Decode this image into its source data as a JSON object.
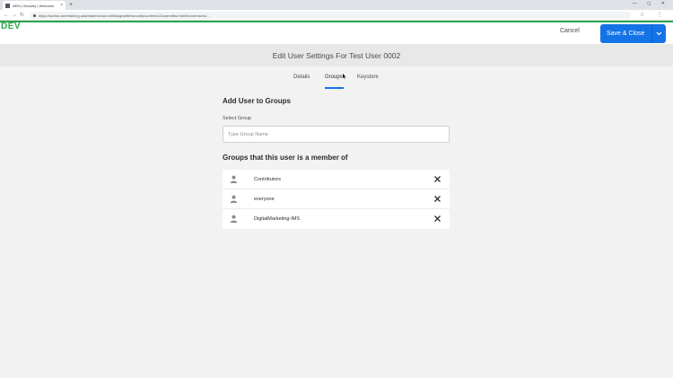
{
  "browser": {
    "tab_title": "AEM | Security | Welcome",
    "tab_close": "×",
    "new_tab": "+",
    "url": "https://author-aemtraining.adobeaemcloud.net/libs/granite/security/content/v2/usereditor.html/home/users/...",
    "window_controls": "— ◻ ✕",
    "extensions": "☆ ⋮"
  },
  "app": {
    "env_label": "DEV",
    "cancel_label": "Cancel",
    "save_label": "Save & Close",
    "accent_color": "#1473e6"
  },
  "page": {
    "title": "Edit User Settings For Test User 0002"
  },
  "tabs": [
    {
      "label": "Details",
      "active": false
    },
    {
      "label": "Groups",
      "active": true
    },
    {
      "label": "Keystore",
      "active": false
    }
  ],
  "add_section": {
    "heading": "Add User to Groups",
    "field_label": "Select Group",
    "placeholder": "Type Group Name",
    "value": ""
  },
  "member_section": {
    "heading": "Groups that this user is a member of",
    "groups": [
      {
        "name": "Contributors",
        "icon": "user-icon",
        "remove_icon": "close-icon"
      },
      {
        "name": "everyone",
        "icon": "user-icon",
        "remove_icon": "close-icon"
      },
      {
        "name": "DigitalMarketing-IMS",
        "icon": "user-icon",
        "remove_icon": "close-icon"
      }
    ]
  }
}
